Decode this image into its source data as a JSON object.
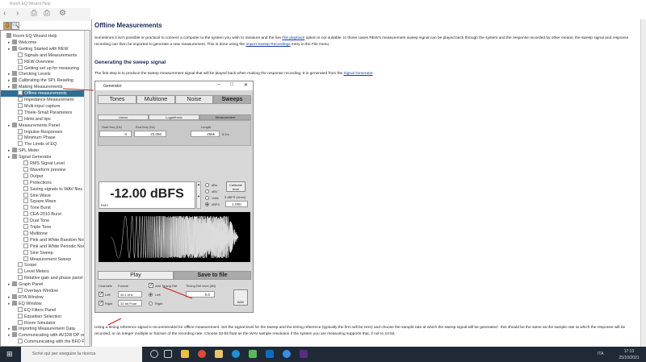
{
  "window": {
    "title": "Room EQ Wizard Help"
  },
  "toolbar": {
    "back": "‹",
    "forward": "›",
    "print": "⎙",
    "print_setup": "⎙",
    "settings": "⚙"
  },
  "nav_tabs": {
    "contents": "▯",
    "search": "🔍"
  },
  "tree": [
    {
      "label": "Room EQ Wizard Help",
      "level": 0,
      "type": "book"
    },
    {
      "label": "Welcome",
      "level": 1,
      "type": "folder"
    },
    {
      "label": "Getting Started with REW",
      "level": 1,
      "type": "folder"
    },
    {
      "label": "Signals and Measurements",
      "level": 2,
      "type": "page"
    },
    {
      "label": "REW Overview",
      "level": 2,
      "type": "page"
    },
    {
      "label": "Getting set up for measuring",
      "level": 2,
      "type": "page"
    },
    {
      "label": "Checking Levels",
      "level": 1,
      "type": "folder"
    },
    {
      "label": "Calibrating the SPL Reading",
      "level": 1,
      "type": "folder"
    },
    {
      "label": "Making Measurements",
      "level": 1,
      "type": "folder"
    },
    {
      "label": "Offline measurements",
      "level": 2,
      "type": "page",
      "selected": true
    },
    {
      "label": "Impedance Measurement",
      "level": 2,
      "type": "page"
    },
    {
      "label": "Multi-input capture",
      "level": 2,
      "type": "page"
    },
    {
      "label": "Thiele-Small Parameters",
      "level": 2,
      "type": "page"
    },
    {
      "label": "Hints and tips",
      "level": 2,
      "type": "page"
    },
    {
      "label": "Measurements Panel",
      "level": 1,
      "type": "folder"
    },
    {
      "label": "Impulse Responses",
      "level": 2,
      "type": "page"
    },
    {
      "label": "Minimum Phase",
      "level": 2,
      "type": "page"
    },
    {
      "label": "The Limits of EQ",
      "level": 2,
      "type": "page"
    },
    {
      "label": "SPL Meter",
      "level": 1,
      "type": "folder"
    },
    {
      "label": "Signal Generator",
      "level": 1,
      "type": "folder"
    },
    {
      "label": "RMS Signal Level",
      "level": 3,
      "type": "page"
    },
    {
      "label": "Waveform preview",
      "level": 3,
      "type": "page"
    },
    {
      "label": "Output",
      "level": 3,
      "type": "page"
    },
    {
      "label": "Protections",
      "level": 3,
      "type": "page"
    },
    {
      "label": "Saving signals to WAV files",
      "level": 3,
      "type": "page"
    },
    {
      "label": "Sine Wave",
      "level": 3,
      "type": "page"
    },
    {
      "label": "Square Wave",
      "level": 3,
      "type": "page"
    },
    {
      "label": "Tone Burst",
      "level": 3,
      "type": "page"
    },
    {
      "label": "CEA-2010 Burst",
      "level": 3,
      "type": "page"
    },
    {
      "label": "Dual Tone",
      "level": 3,
      "type": "page"
    },
    {
      "label": "Triple Tone",
      "level": 3,
      "type": "page"
    },
    {
      "label": "Multitone",
      "level": 3,
      "type": "page"
    },
    {
      "label": "Pink and White Random Noise",
      "level": 3,
      "type": "page"
    },
    {
      "label": "Pink and White Periodic Noise",
      "level": 3,
      "type": "page"
    },
    {
      "label": "Sine Sweep",
      "level": 3,
      "type": "page"
    },
    {
      "label": "Measurement Sweep",
      "level": 3,
      "type": "page"
    },
    {
      "label": "Scope",
      "level": 2,
      "type": "page"
    },
    {
      "label": "Level Meters",
      "level": 2,
      "type": "page"
    },
    {
      "label": "Relative gain and phase panel",
      "level": 2,
      "type": "page"
    },
    {
      "label": "Graph Panel",
      "level": 1,
      "type": "folder"
    },
    {
      "label": "Overlays Window",
      "level": 2,
      "type": "page"
    },
    {
      "label": "RTA Window",
      "level": 1,
      "type": "folder"
    },
    {
      "label": "EQ Window",
      "level": 1,
      "type": "folder"
    },
    {
      "label": "EQ Filters Panel",
      "level": 2,
      "type": "page"
    },
    {
      "label": "Equaliser Selection",
      "level": 2,
      "type": "page"
    },
    {
      "label": "Room Simulator",
      "level": 2,
      "type": "page"
    },
    {
      "label": "Importing Measurement Data",
      "level": 1,
      "type": "folder"
    },
    {
      "label": "Communicating with AV32R DP or AV",
      "level": 1,
      "type": "folder"
    },
    {
      "label": "Communicating with the BFD Pro",
      "level": 2,
      "type": "page"
    }
  ],
  "content": {
    "title": "Offline Measurements",
    "intro_1": "Sometimes it isn't possible or practical to connect a computer to the system you wish to measure and the live ",
    "intro_link1": "File playback",
    "intro_2": " option is not suitable. In those cases REW's measurement sweep signal can be played back through the system and the response recorded by other means, the sweep signal and response recording can then be imported to generate a new measurement. This is done using the ",
    "intro_link2": "Import Sweep Recordings",
    "intro_3": " entry in the File menu.",
    "heading": "Generating the sweep signal",
    "step_1": "The first step is to produce the sweep measurement signal that will be played back when making the response recording. It is generated from the ",
    "step_link": "Signal Generator",
    "step_2": ".",
    "bottom": "Using a timing reference signal is recommended for offline measurement. Set the signal level for the sweep and the timing reference (typically the firm will be zero) and choose the sample rate at which the sweep signal will be generated - this should be the same as the sample rate at which the response will be recorded, or an integer multiple or fraction of the recording rate. Choose 32-bit float as the WAV sample resolution if the system you are measuring supports that, if not to 24-bit."
  },
  "generator": {
    "title": "Generator",
    "tabs": [
      "Tones",
      "Multitone",
      "Noise",
      "Sweeps"
    ],
    "selected_tab": "Sweeps",
    "sweep_tabs": [
      "Linear",
      "Logarithmic",
      "Measurement"
    ],
    "selected_sweep_tab": "Measurement",
    "start_label": "Start freq (Hz)",
    "start_value": "0",
    "end_label": "End freq (Hz)",
    "end_value": "22,050",
    "length_label": "Length",
    "length_value": "256k",
    "length_seconds": "5.9 s",
    "level": "-12.00 dBFS",
    "level_mode": "RMS",
    "units": [
      "dBu",
      "dBV",
      "Volts",
      "dBFS"
    ],
    "selected_unit": "dBFS",
    "calibrate": "Calibrate level",
    "fs_label": "0 dBFS (Vrms)",
    "fs_value": "1.000",
    "play": "Play",
    "save": "Save to file",
    "channels_label": "Channels",
    "left": "Left",
    "right": "Right",
    "format_label": "Format",
    "rate": "44.1 kHz",
    "bits": "32-bit Float",
    "timing_ref": "Add Timing Ref",
    "timing_left": "Left",
    "timing_right": "Right",
    "timing_level_label": "Timing Ref level (dB)",
    "timing_level": "0.0",
    "wav": "WAV"
  },
  "taskbar": {
    "search_placeholder": "Scrivi qui per eseguire la ricerca",
    "lang": "ITA",
    "time": "17:13",
    "date": "25/10/2021"
  },
  "colors": {
    "selection": "#2f6e94",
    "heading": "#1a2a5a",
    "link": "#1a3ca0",
    "annotation_arrow": "#d0201a"
  }
}
